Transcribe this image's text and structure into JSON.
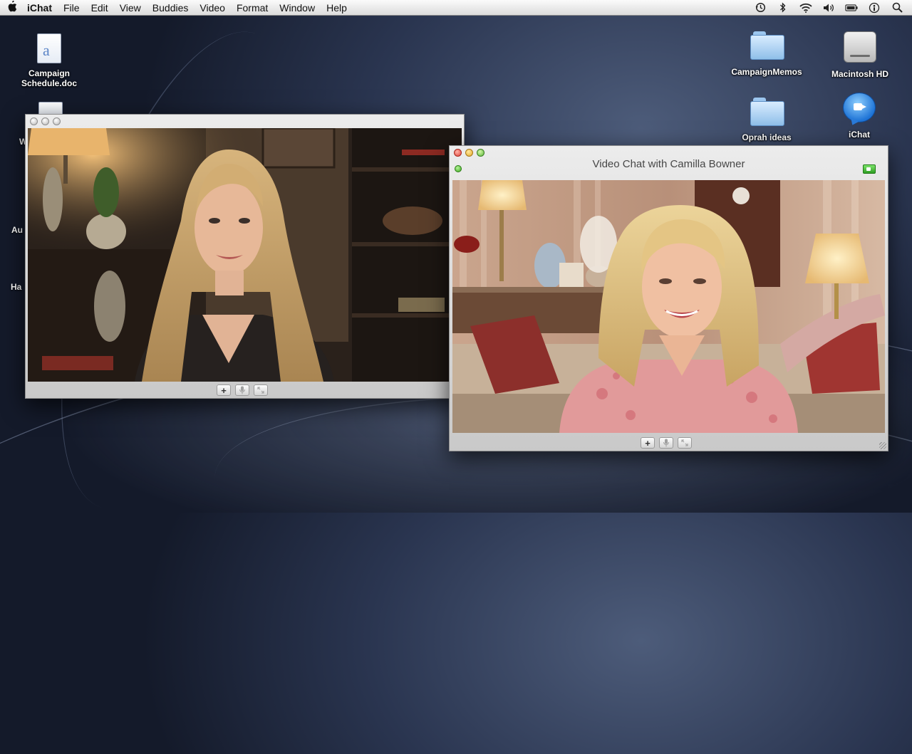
{
  "menubar": {
    "app_name": "iChat",
    "items": [
      "File",
      "Edit",
      "View",
      "Buddies",
      "Video",
      "Format",
      "Window",
      "Help"
    ]
  },
  "desktop": {
    "icons": [
      {
        "label_line1": "Campaign",
        "label_line2": "Schedule.doc",
        "icon": "document-icon"
      },
      {
        "label": "CampaignMemos",
        "icon": "folder-icon"
      },
      {
        "label": "Macintosh HD",
        "icon": "hard-drive-icon"
      },
      {
        "label": "Oprah ideas",
        "icon": "folder-icon"
      },
      {
        "label": "iChat",
        "icon": "ichat-icon"
      }
    ],
    "clipped_labels": [
      "W",
      "Au",
      "Ha"
    ]
  },
  "back_window": {
    "title": "",
    "controls": [
      "+",
      "mic",
      "fullscreen"
    ]
  },
  "chat_window": {
    "title": "Video Chat with Camilla Bowner",
    "controls": [
      "+",
      "mic",
      "fullscreen"
    ]
  },
  "colors": {
    "desktop": "#2a3550",
    "menubar": "#ececec",
    "window_chrome": "#d9d9d9",
    "status_green": "#3aa61d"
  }
}
